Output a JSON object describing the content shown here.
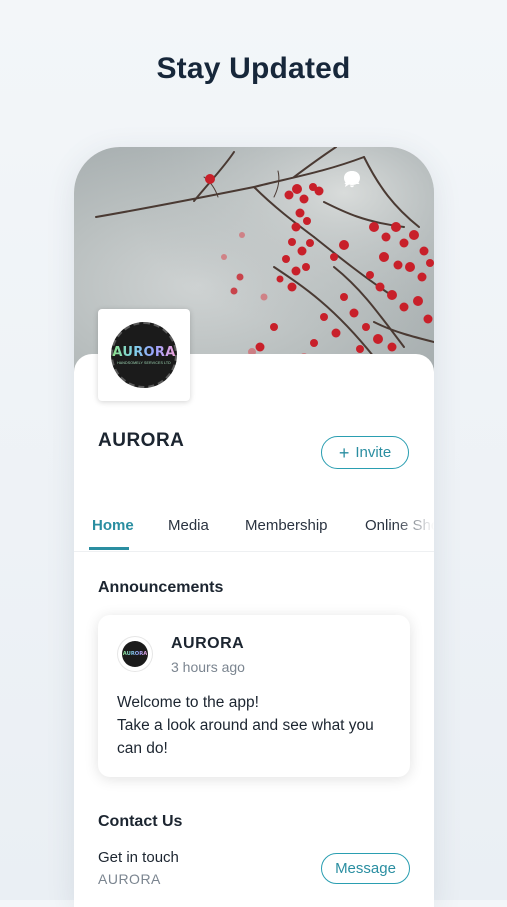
{
  "headline": "Stay Updated",
  "header": {
    "icons": [
      "chat-bubble-icon",
      "bell-icon"
    ]
  },
  "site": {
    "name": "AURORA",
    "logo_text": "AURORA",
    "logo_subtext": "HANDSOMELY SERVICES LTD"
  },
  "buttons": {
    "invite_label": "Invite",
    "invite_icon": "+",
    "message_label": "Message"
  },
  "tabs": [
    {
      "label": "Home",
      "active": true
    },
    {
      "label": "Media",
      "active": false
    },
    {
      "label": "Membership",
      "active": false
    },
    {
      "label": "Online Sho",
      "active": false
    }
  ],
  "announcements": {
    "title": "Announcements",
    "post": {
      "author": "AURORA",
      "time": "3 hours ago",
      "lines": [
        "Welcome to the app!",
        "Take a look around and see what you",
        "can do!"
      ]
    }
  },
  "contact": {
    "title": "Contact Us",
    "line1": "Get in touch",
    "line2": "AURORA"
  },
  "colors": {
    "accent": "#2a8ea1",
    "text": "#1c2530",
    "muted": "#7b8590",
    "berry": "#c8202a"
  }
}
